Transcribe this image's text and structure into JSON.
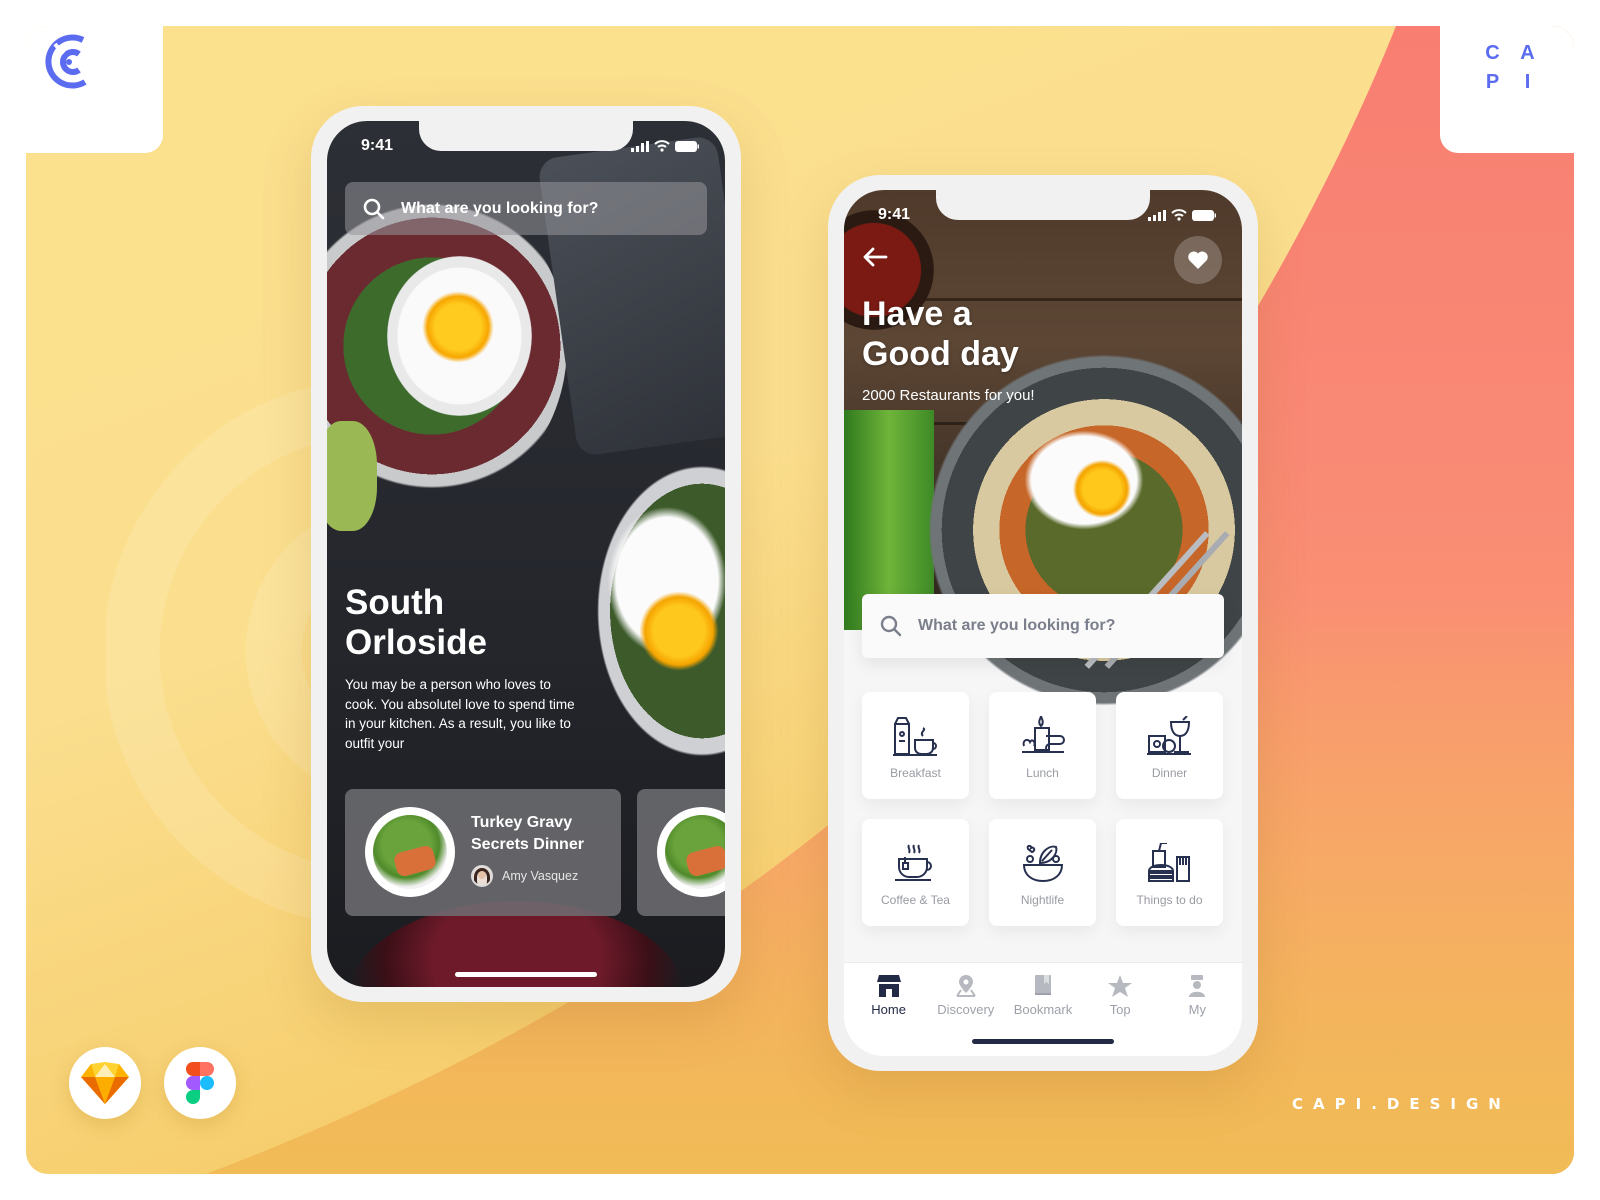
{
  "branding": {
    "logo_icon": "capi-c-logo-icon",
    "logo_letters": [
      "C",
      "A",
      "P",
      "I"
    ],
    "site_mark": "CAPI.DESIGN",
    "tools": [
      {
        "name": "Sketch",
        "icon": "sketch-diamond-icon"
      },
      {
        "name": "Figma",
        "icon": "figma-icon"
      }
    ],
    "colors": {
      "accent_blue": "#5b6cf0",
      "bg_yellow": "#fbe08e",
      "bg_coral": "#f87e72",
      "nav_active": "#232a45",
      "nav_inactive": "#9ea1aa"
    }
  },
  "phone_left": {
    "status": {
      "time": "9:41",
      "icons": [
        "signal-icon",
        "wifi-icon",
        "battery-icon"
      ]
    },
    "search": {
      "placeholder": "What are you looking for?",
      "icon": "search-icon"
    },
    "title_line1": "South",
    "title_line2": "Orloside",
    "description": "You may be a person who loves to cook. You absolutel love to spend time in your kitchen. As a result, you like to outfit your",
    "recipes": [
      {
        "title_line1": "Turkey Gravy",
        "title_line2": "Secrets Dinner",
        "author": "Amy Vasquez"
      },
      {
        "title_line1": "",
        "title_line2": "",
        "author": ""
      }
    ]
  },
  "phone_right": {
    "status": {
      "time": "9:41",
      "icons": [
        "signal-icon",
        "wifi-icon",
        "battery-icon"
      ]
    },
    "back_icon": "arrow-left-icon",
    "favorite_icon": "heart-icon",
    "title_line1": "Have a",
    "title_line2": "Good day",
    "subtitle": "2000 Restaurants for you!",
    "search": {
      "placeholder": "What are you looking for?",
      "icon": "search-icon"
    },
    "categories": [
      {
        "label": "Breakfast",
        "icon": "breakfast-icon"
      },
      {
        "label": "Lunch",
        "icon": "lunch-icon"
      },
      {
        "label": "Dinner",
        "icon": "dinner-icon"
      },
      {
        "label": "Coffee & Tea",
        "icon": "coffee-tea-icon"
      },
      {
        "label": "Nightlife",
        "icon": "nightlife-icon"
      },
      {
        "label": "Things to do",
        "icon": "things-to-do-icon"
      }
    ],
    "tabs": [
      {
        "label": "Home",
        "icon": "store-icon",
        "active": true
      },
      {
        "label": "Discovery",
        "icon": "map-pin-icon",
        "active": false
      },
      {
        "label": "Bookmark",
        "icon": "bookmark-icon",
        "active": false
      },
      {
        "label": "Top",
        "icon": "star-icon",
        "active": false
      },
      {
        "label": "My",
        "icon": "chef-icon",
        "active": false
      }
    ]
  }
}
